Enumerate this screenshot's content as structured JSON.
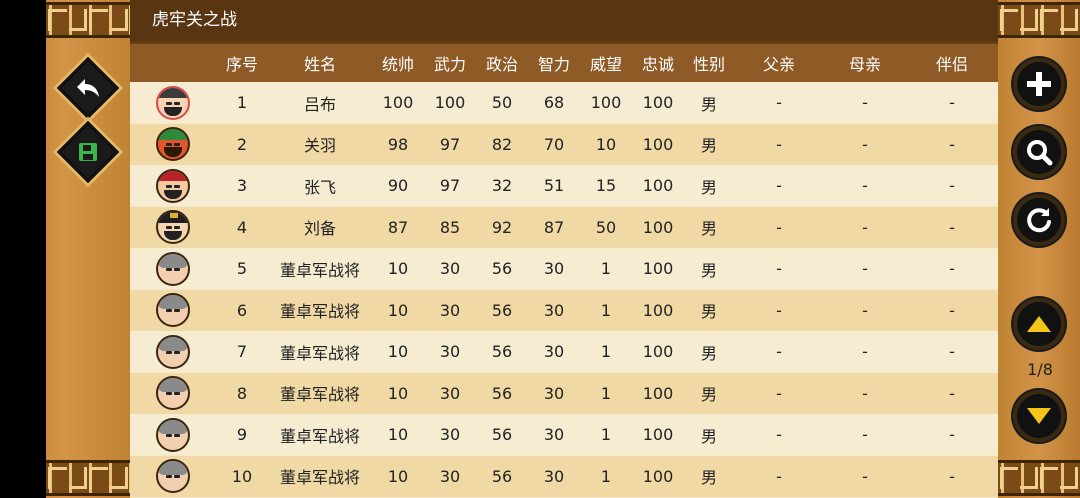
{
  "window": {
    "title": "虎牢关之战"
  },
  "table": {
    "columns": [
      "",
      "序号",
      "姓名",
      "统帅",
      "武力",
      "政治",
      "智力",
      "威望",
      "忠诚",
      "性别",
      "父亲",
      "母亲",
      "伴侣"
    ],
    "rows": [
      {
        "no": "1",
        "name": "吕布",
        "lead": "100",
        "war": "100",
        "pol": "50",
        "int": "68",
        "pres": "100",
        "loy": "100",
        "sex": "男",
        "father": "-",
        "mother": "-",
        "spouse": "-",
        "avatar": "lu-bu-portrait"
      },
      {
        "no": "2",
        "name": "关羽",
        "lead": "98",
        "war": "97",
        "pol": "82",
        "int": "70",
        "pres": "10",
        "loy": "100",
        "sex": "男",
        "father": "-",
        "mother": "-",
        "spouse": "-",
        "avatar": "guan-yu-portrait"
      },
      {
        "no": "3",
        "name": "张飞",
        "lead": "90",
        "war": "97",
        "pol": "32",
        "int": "51",
        "pres": "15",
        "loy": "100",
        "sex": "男",
        "father": "-",
        "mother": "-",
        "spouse": "-",
        "avatar": "zhang-fei-portrait"
      },
      {
        "no": "4",
        "name": "刘备",
        "lead": "87",
        "war": "85",
        "pol": "92",
        "int": "87",
        "pres": "50",
        "loy": "100",
        "sex": "男",
        "father": "-",
        "mother": "-",
        "spouse": "-",
        "avatar": "liu-bei-portrait"
      },
      {
        "no": "5",
        "name": "董卓军战将",
        "lead": "10",
        "war": "30",
        "pol": "56",
        "int": "30",
        "pres": "1",
        "loy": "100",
        "sex": "男",
        "father": "-",
        "mother": "-",
        "spouse": "-",
        "avatar": "generic-general-portrait"
      },
      {
        "no": "6",
        "name": "董卓军战将",
        "lead": "10",
        "war": "30",
        "pol": "56",
        "int": "30",
        "pres": "1",
        "loy": "100",
        "sex": "男",
        "father": "-",
        "mother": "-",
        "spouse": "-",
        "avatar": "generic-general-portrait"
      },
      {
        "no": "7",
        "name": "董卓军战将",
        "lead": "10",
        "war": "30",
        "pol": "56",
        "int": "30",
        "pres": "1",
        "loy": "100",
        "sex": "男",
        "father": "-",
        "mother": "-",
        "spouse": "-",
        "avatar": "generic-general-portrait"
      },
      {
        "no": "8",
        "name": "董卓军战将",
        "lead": "10",
        "war": "30",
        "pol": "56",
        "int": "30",
        "pres": "1",
        "loy": "100",
        "sex": "男",
        "father": "-",
        "mother": "-",
        "spouse": "-",
        "avatar": "generic-general-portrait"
      },
      {
        "no": "9",
        "name": "董卓军战将",
        "lead": "10",
        "war": "30",
        "pol": "56",
        "int": "30",
        "pres": "1",
        "loy": "100",
        "sex": "男",
        "father": "-",
        "mother": "-",
        "spouse": "-",
        "avatar": "generic-general-portrait"
      },
      {
        "no": "10",
        "name": "董卓军战将",
        "lead": "10",
        "war": "30",
        "pol": "56",
        "int": "30",
        "pres": "1",
        "loy": "100",
        "sex": "男",
        "father": "-",
        "mother": "-",
        "spouse": "-",
        "avatar": "generic-general-portrait"
      }
    ]
  },
  "pagination": {
    "indicator": "1/8"
  },
  "icons": {
    "back": "back-arrow-icon",
    "save": "save-icon",
    "add": "plus-icon",
    "search": "search-icon",
    "refresh": "refresh-icon",
    "up": "arrow-up-icon",
    "down": "arrow-down-icon"
  },
  "colors": {
    "title_bar": "#5a3512",
    "header_row": "#8e5a25",
    "row_alt": "#f0d9a4",
    "row_plain": "#f5ecd2",
    "frame": "#c9893a"
  }
}
